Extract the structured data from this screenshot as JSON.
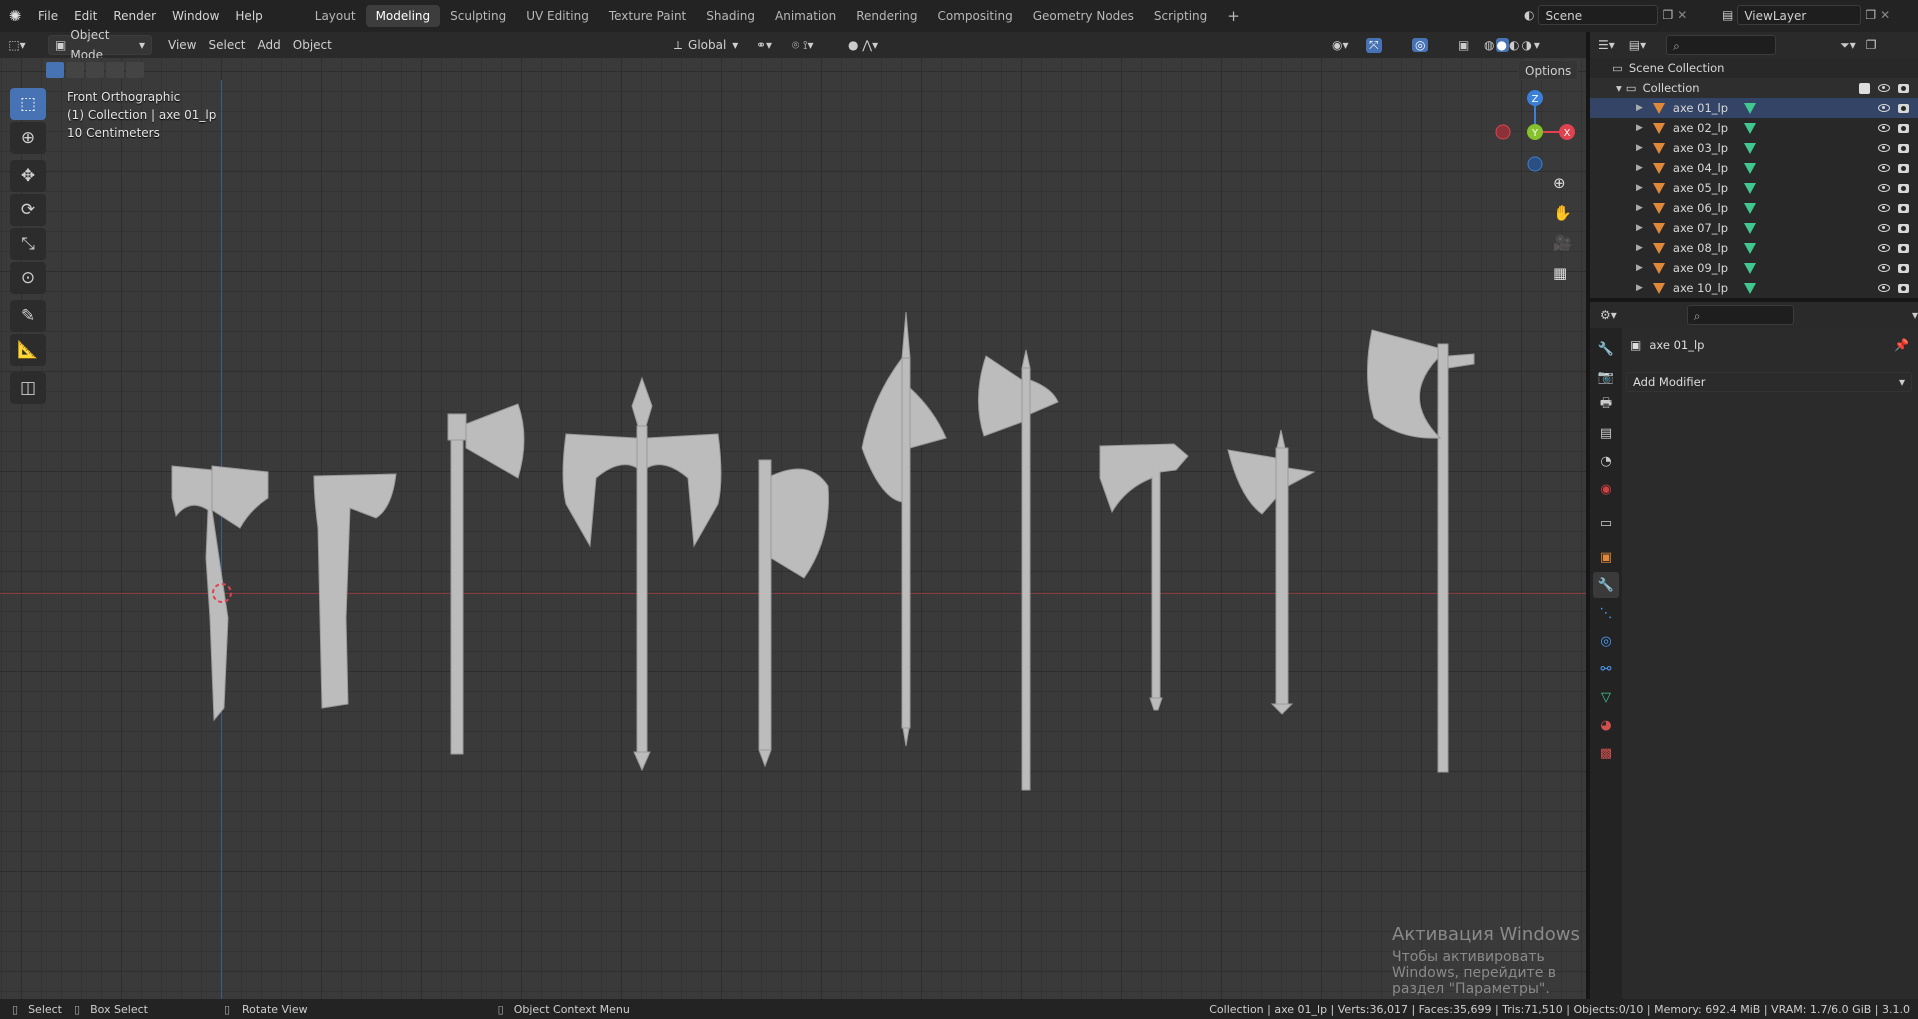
{
  "topbar": {
    "menus": [
      "File",
      "Edit",
      "Render",
      "Window",
      "Help"
    ],
    "workspaces": [
      "Layout",
      "Modeling",
      "Sculpting",
      "UV Editing",
      "Texture Paint",
      "Shading",
      "Animation",
      "Rendering",
      "Compositing",
      "Geometry Nodes",
      "Scripting"
    ],
    "active_workspace": "Modeling",
    "add_tab": "+",
    "scene": "Scene",
    "view_layer": "ViewLayer"
  },
  "viewport_header": {
    "mode": "Object Mode",
    "menus": [
      "View",
      "Select",
      "Add",
      "Object"
    ],
    "transform_orientation": "Global",
    "options": "Options"
  },
  "viewport": {
    "view_name": "Front Orthographic",
    "collection_line": "(1) Collection | axe 01_lp",
    "scale": "10 Centimeters",
    "gizmo": {
      "z": "Z",
      "y": "Y",
      "x": "X"
    }
  },
  "outliner": {
    "scene_collection": "Scene Collection",
    "collection": "Collection",
    "objects": [
      "axe 01_lp",
      "axe 02_lp",
      "axe 03_lp",
      "axe 04_lp",
      "axe 05_lp",
      "axe 06_lp",
      "axe 07_lp",
      "axe 08_lp",
      "axe 09_lp",
      "axe 10_lp"
    ]
  },
  "properties": {
    "object_name": "axe 01_lp",
    "add_modifier": "Add Modifier"
  },
  "watermark": {
    "title": "Активация Windows",
    "subtitle": "Чтобы активировать Windows, перейдите в раздел \"Параметры\"."
  },
  "statusbar": {
    "select": "Select",
    "box_select": "Box Select",
    "rotate_view": "Rotate View",
    "context_menu": "Object Context Menu",
    "stats": "Collection | axe 01_lp | Verts:36,017 | Faces:35,699 | Tris:71,510 | Objects:0/10 | Memory: 692.4 MiB | VRAM: 1.7/6.0 GiB | 3.1.0"
  },
  "colors": {
    "accent": "#4772b3",
    "object": "#e0883a",
    "mesh": "#40c890",
    "axis_x": "#e0424f",
    "axis_y": "#86c22c",
    "axis_z": "#3a7fd8"
  }
}
